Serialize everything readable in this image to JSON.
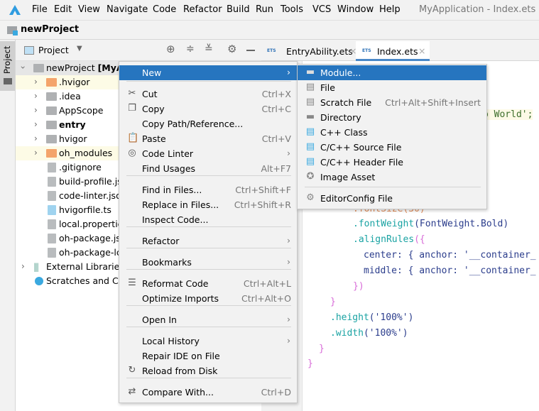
{
  "menubar": {
    "items": [
      "File",
      "Edit",
      "View",
      "Navigate",
      "Code",
      "Refactor",
      "Build",
      "Run",
      "Tools",
      "VCS",
      "Window",
      "Help"
    ],
    "title": "MyApplication - Index.ets [en"
  },
  "project_bar": {
    "name": "newProject"
  },
  "sidebar_tab": "Project",
  "panel": {
    "view_label": "Project",
    "tree": [
      {
        "label": "newProject [MyAp",
        "bold": true
      },
      {
        "label": ".hvigor"
      },
      {
        "label": ".idea"
      },
      {
        "label": "AppScope"
      },
      {
        "label": "entry"
      },
      {
        "label": "hvigor"
      },
      {
        "label": "oh_modules"
      },
      {
        "label": ".gitignore"
      },
      {
        "label": "build-profile.js"
      },
      {
        "label": "code-linter.jso"
      },
      {
        "label": "hvigorfile.ts"
      },
      {
        "label": "local.propertie"
      },
      {
        "label": "oh-package.js"
      },
      {
        "label": "oh-package-lc"
      },
      {
        "label": "External Libraries"
      },
      {
        "label": "Scratches and Co"
      }
    ]
  },
  "tabs": [
    {
      "label": "EntryAbility.ets",
      "active": false
    },
    {
      "label": "Index.ets",
      "active": true
    }
  ],
  "code": {
    "l1": "o World';",
    "l2": ".fontSize(30)",
    "l3a": ".fontWeight",
    "l3b": "(FontWeight.Bold)",
    "l4a": ".alignRules",
    "l4b": "({",
    "l5a": "center: ",
    "l5b": "{ anchor: '__container_",
    "l6a": "middle: ",
    "l6b": "{ anchor: '__container_",
    "l7": "})",
    "l8": "}",
    "l9a": ".height",
    "l9b": "('100%')",
    "l10a": ".width",
    "l10b": "('100%')",
    "l11": "}",
    "l12": "}"
  },
  "context_menu": [
    {
      "label": "New",
      "submenu": true,
      "selected": true
    },
    {
      "label": "Cut",
      "shortcut": "Ctrl+X",
      "icon": "scissors"
    },
    {
      "label": "Copy",
      "shortcut": "Ctrl+C",
      "icon": "copy"
    },
    {
      "label": "Copy Path/Reference..."
    },
    {
      "label": "Paste",
      "shortcut": "Ctrl+V",
      "icon": "clipboard"
    },
    {
      "label": "Code Linter",
      "submenu": true,
      "icon": "linter"
    },
    {
      "label": "Find Usages",
      "shortcut": "Alt+F7"
    },
    {
      "label": "Find in Files...",
      "shortcut": "Ctrl+Shift+F"
    },
    {
      "label": "Replace in Files...",
      "shortcut": "Ctrl+Shift+R"
    },
    {
      "label": "Inspect Code..."
    },
    {
      "label": "Refactor",
      "submenu": true
    },
    {
      "label": "Bookmarks",
      "submenu": true
    },
    {
      "label": "Reformat Code",
      "shortcut": "Ctrl+Alt+L",
      "icon": "reformat"
    },
    {
      "label": "Optimize Imports",
      "shortcut": "Ctrl+Alt+O"
    },
    {
      "label": "Open In",
      "submenu": true
    },
    {
      "label": "Local History",
      "submenu": true
    },
    {
      "label": "Repair IDE on File"
    },
    {
      "label": "Reload from Disk",
      "icon": "reload"
    },
    {
      "label": "Compare With...",
      "shortcut": "Ctrl+D",
      "icon": "compare"
    }
  ],
  "submenu": [
    {
      "label": "Module...",
      "selected": true
    },
    {
      "label": "File"
    },
    {
      "label": "Scratch File",
      "shortcut": "Ctrl+Alt+Shift+Insert"
    },
    {
      "label": "Directory"
    },
    {
      "label": "C++ Class"
    },
    {
      "label": "C/C++ Source File"
    },
    {
      "label": "C/C++ Header File"
    },
    {
      "label": "Image Asset"
    },
    {
      "label": "EditorConfig File"
    }
  ],
  "colors": {
    "selection": "#2675bf",
    "accent": "#3aa9e0",
    "folder_excluded": "#f4a46b"
  }
}
